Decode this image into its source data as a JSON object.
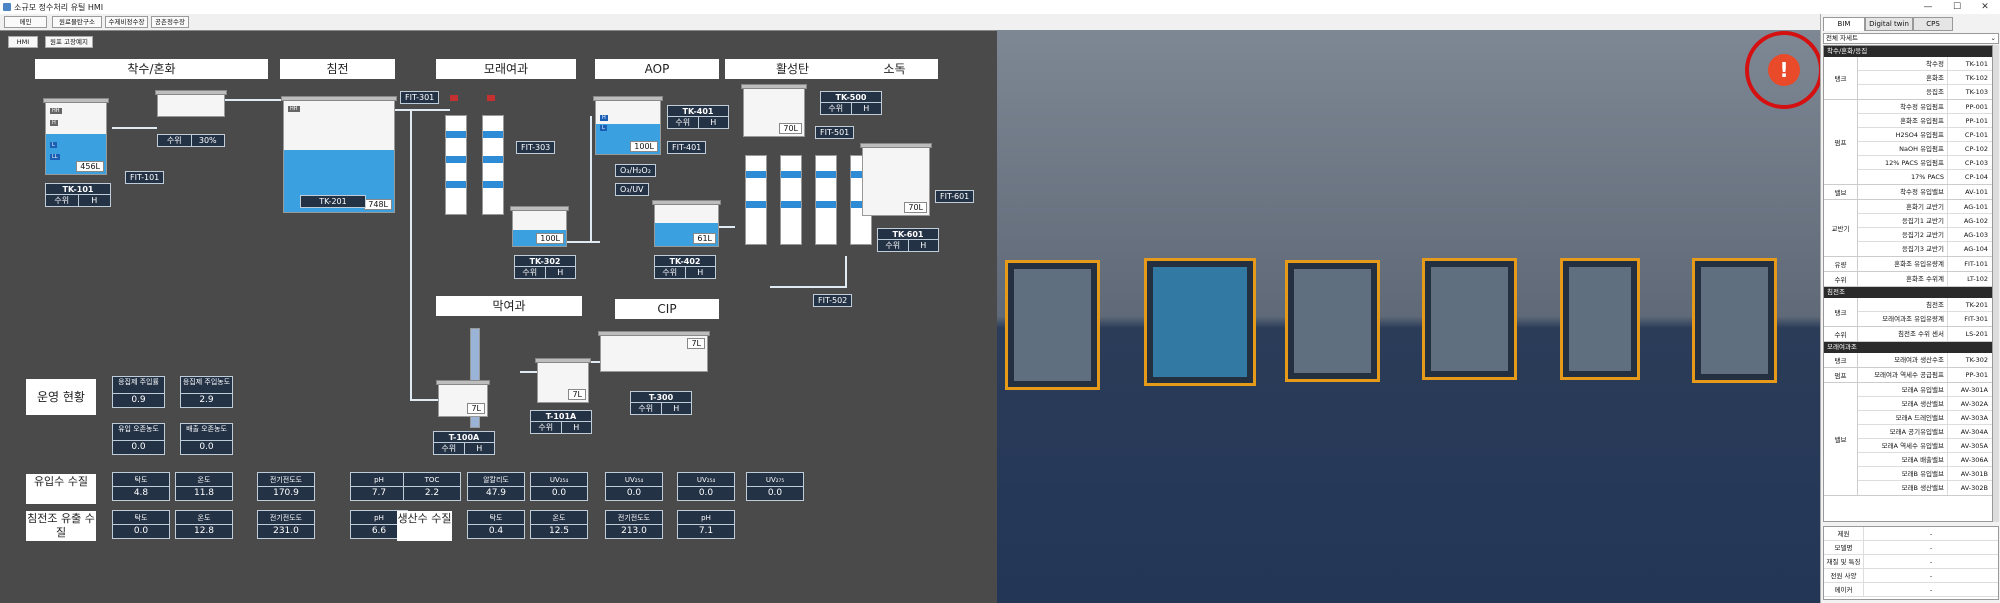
{
  "window": {
    "title": "소규모 정수처리 유틸 HMI",
    "controls": [
      "—",
      "☐",
      "✕"
    ]
  },
  "menu": [
    "메인",
    "원료물탄구소",
    "수제비정수장",
    "공촌정수장"
  ],
  "hmi": {
    "tabs": [
      "HMI",
      "원포 고장예지"
    ],
    "sections": {
      "intake": "착수/혼화",
      "sedimentation": "침전",
      "sand": "모래여과",
      "aop": "AOP",
      "carbon": "활성탄",
      "disinfection": "소독",
      "membrane": "막여과",
      "cip": "CIP"
    },
    "tanks": {
      "tk101": {
        "name": "TK-101",
        "level_label": "수위",
        "level_value": "H",
        "volume": "456L",
        "fill": 0.55
      },
      "mix": {
        "level_label": "수위",
        "level_value": "30%"
      },
      "tk201": {
        "volume": "748L",
        "fill": 0.55
      },
      "tk302": {
        "name": "TK-302",
        "level_label": "수위",
        "level_value": "H",
        "volume": "100L"
      },
      "tk401": {
        "name": "TK-401",
        "level_label": "수위",
        "level_value": "H",
        "volume": "100L"
      },
      "tk402": {
        "name": "TK-402",
        "level_label": "수위",
        "level_value": "H",
        "volume": "61L"
      },
      "tk500": {
        "name": "TK-500",
        "level_label": "수위",
        "level_value": "H",
        "volume": "70L"
      },
      "tk601": {
        "name": "TK-601",
        "level_label": "수위",
        "level_value": "H",
        "volume": "70L"
      },
      "t100a": {
        "name": "T-100A",
        "level_label": "수위",
        "level_value": "H",
        "volume": "7L"
      },
      "t101a": {
        "name": "T-101A",
        "level_label": "수위",
        "level_value": "H",
        "volume": "7L"
      },
      "t300": {
        "name": "T-300",
        "level_label": "수위",
        "level_value": "H",
        "volume": "7L"
      }
    },
    "flow_tags": {
      "fit101": "FIT-101",
      "tk201": "TK-201",
      "fit301": "FIT-301",
      "fit303": "FIT-303",
      "fit401": "FIT-401",
      "fit501": "FIT-501",
      "fit502": "FIT-502",
      "fit601": "FIT-601",
      "o3h2o2": "O₃/H₂O₂",
      "o3uv": "O₃/UV"
    },
    "levels": {
      "HH": "HH",
      "H": "H",
      "L": "L",
      "LL": "LL"
    },
    "status": {
      "title": "운영 현황",
      "boxes": [
        {
          "k": "응집제 주입률",
          "v": "0.9"
        },
        {
          "k": "응집제 주입농도",
          "v": "2.9"
        },
        {
          "k": "유입 오존농도",
          "v": "0.0"
        },
        {
          "k": "배출 오존농도",
          "v": "0.0"
        }
      ]
    },
    "inflow": {
      "title": "유입수 수질",
      "cells": [
        {
          "k": "탁도",
          "v": "4.8"
        },
        {
          "k": "온도",
          "v": "11.8"
        },
        {
          "k": "전기전도도",
          "v": "170.9"
        },
        {
          "k": "pH",
          "v": "7.7"
        },
        {
          "k": "TOC",
          "v": "2.2"
        },
        {
          "k": "알칼리도",
          "v": "47.9"
        },
        {
          "k": "UV₂₅₄",
          "v": "0.0"
        },
        {
          "k": "UV₂₅₄",
          "v": "0.0"
        },
        {
          "k": "UV₂₅₄",
          "v": "0.0"
        },
        {
          "k": "UV₂₇₅",
          "v": "0.0"
        }
      ]
    },
    "sed_out": {
      "title": "침전조 유출 수질",
      "cells": [
        {
          "k": "탁도",
          "v": "0.0"
        },
        {
          "k": "온도",
          "v": "12.8"
        },
        {
          "k": "전기전도도",
          "v": "231.0"
        },
        {
          "k": "pH",
          "v": "6.6"
        }
      ]
    },
    "product": {
      "title": "생산수 수질",
      "cells": [
        {
          "k": "탁도",
          "v": "0.4"
        },
        {
          "k": "온도",
          "v": "12.5"
        },
        {
          "k": "전기전도도",
          "v": "213.0"
        },
        {
          "k": "pH",
          "v": "7.1"
        }
      ]
    }
  },
  "viewport": {
    "alert_symbol": "!"
  },
  "side": {
    "tabs": [
      "BIM",
      "Digital twin",
      "CPS"
    ],
    "filter": "전체 자세트",
    "groups": [
      {
        "title": "착수/혼화/응집",
        "cats": [
          {
            "name": "탱크",
            "items": [
              [
                "착수정",
                "TK-101"
              ],
              [
                "혼화조",
                "TK-102"
              ],
              [
                "응집조",
                "TK-103"
              ]
            ]
          },
          {
            "name": "펌프",
            "items": [
              [
                "착수정 유입펌프",
                "PP-001"
              ],
              [
                "혼화조 유입펌프",
                "PP-101"
              ],
              [
                "H2SO4 유입펌프",
                "CP-101"
              ],
              [
                "NaOH 유입펌프",
                "CP-102"
              ],
              [
                "12% PACS 유입펌프",
                "CP-103"
              ],
              [
                "17% PACS",
                "CP-104"
              ]
            ]
          },
          {
            "name": "밸브",
            "items": [
              [
                "착수정 유입밸브",
                "AV-101"
              ]
            ]
          },
          {
            "name": "교반기",
            "items": [
              [
                "혼화기 교반기",
                "AG-101"
              ],
              [
                "응집기1 교반기",
                "AG-102"
              ],
              [
                "응집기2 교반기",
                "AG-103"
              ],
              [
                "응집기3 교반기",
                "AG-104"
              ]
            ]
          },
          {
            "name": "유량",
            "items": [
              [
                "혼화조 유입유량계",
                "FIT-101"
              ]
            ]
          },
          {
            "name": "수위",
            "items": [
              [
                "혼화조 수위계",
                "LT-102"
              ]
            ]
          }
        ]
      },
      {
        "title": "침전조",
        "cats": [
          {
            "name": "탱크",
            "items": [
              [
                "침전조",
                "TK-201"
              ],
              [
                "모래여과조 유입유량계",
                "FIT-301"
              ]
            ]
          },
          {
            "name": "수위",
            "items": [
              [
                "침전조 수위 센서",
                "LS-201"
              ]
            ]
          }
        ]
      },
      {
        "title": "모래여과조",
        "cats": [
          {
            "name": "탱크",
            "items": [
              [
                "모래여과 생산수조",
                "TK-302"
              ]
            ]
          },
          {
            "name": "펌프",
            "items": [
              [
                "모래여과 역세수 공급펌프",
                "PP-301"
              ]
            ]
          },
          {
            "name": "밸브",
            "items": [
              [
                "모래A 유입밸브",
                "AV-301A"
              ],
              [
                "모래A 생산밸브",
                "AV-302A"
              ],
              [
                "모래A 드레인밸브",
                "AV-303A"
              ],
              [
                "모래A 공기유입밸브",
                "AV-304A"
              ],
              [
                "모래A 역세수 유입밸브",
                "AV-305A"
              ],
              [
                "모래A 배출밸브",
                "AV-306A"
              ],
              [
                "모래B 유입밸브",
                "AV-301B"
              ],
              [
                "모래B 생산밸브",
                "AV-302B"
              ]
            ]
          }
        ]
      }
    ],
    "props": [
      {
        "k": "제원",
        "v": "-"
      },
      {
        "k": "모델명",
        "v": "-"
      },
      {
        "k": "재질 및 특징",
        "v": "-"
      },
      {
        "k": "전원 사양",
        "v": "-"
      },
      {
        "k": "메이커",
        "v": "-"
      }
    ]
  }
}
